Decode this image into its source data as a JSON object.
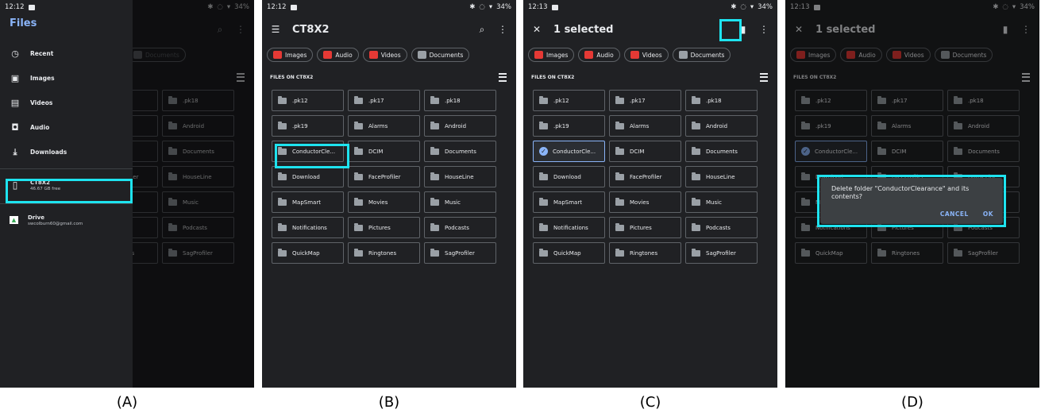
{
  "status": {
    "time_a": "12:12",
    "time_b": "12:12",
    "time_c": "12:13",
    "time_d": "12:13",
    "battery": "34%"
  },
  "captions": [
    "(A)",
    "(B)",
    "(C)",
    "(D)"
  ],
  "drawer": {
    "title": "Files",
    "items": [
      {
        "label": "Recent",
        "icon": "clock-icon"
      },
      {
        "label": "Images",
        "icon": "image-icon"
      },
      {
        "label": "Videos",
        "icon": "film-icon"
      },
      {
        "label": "Audio",
        "icon": "audio-icon"
      },
      {
        "label": "Downloads",
        "icon": "download-icon"
      }
    ],
    "device": {
      "name": "CT8X2",
      "free": "46.67 GB free"
    },
    "drive": {
      "name": "Drive",
      "account": "swcolburn60@gmail.com"
    }
  },
  "appbar": {
    "title": "CT8X2",
    "selected": "1 selected"
  },
  "chips": [
    {
      "label": "Images",
      "color": "#e53935"
    },
    {
      "label": "Audio",
      "color": "#e53935"
    },
    {
      "label": "Videos",
      "color": "#e53935"
    },
    {
      "label": "Documents",
      "color": "#9aa0a6"
    }
  ],
  "section_title": "FILES ON CT8X2",
  "folders": [
    ".pk12",
    ".pk17",
    ".pk18",
    ".pk19",
    "Alarms",
    "Android",
    "ConductorCle...",
    "DCIM",
    "Documents",
    "Download",
    "FaceProfiler",
    "HouseLine",
    "MapSmart",
    "Movies",
    "Music",
    "Notifications",
    "Pictures",
    "Podcasts",
    "QuickMap",
    "Ringtones",
    "SagProfiler"
  ],
  "dialog": {
    "message": "Delete folder \"ConductorClearance\" and its contents?",
    "cancel": "CANCEL",
    "ok": "OK"
  },
  "highlight_color": "#1ee3ef"
}
